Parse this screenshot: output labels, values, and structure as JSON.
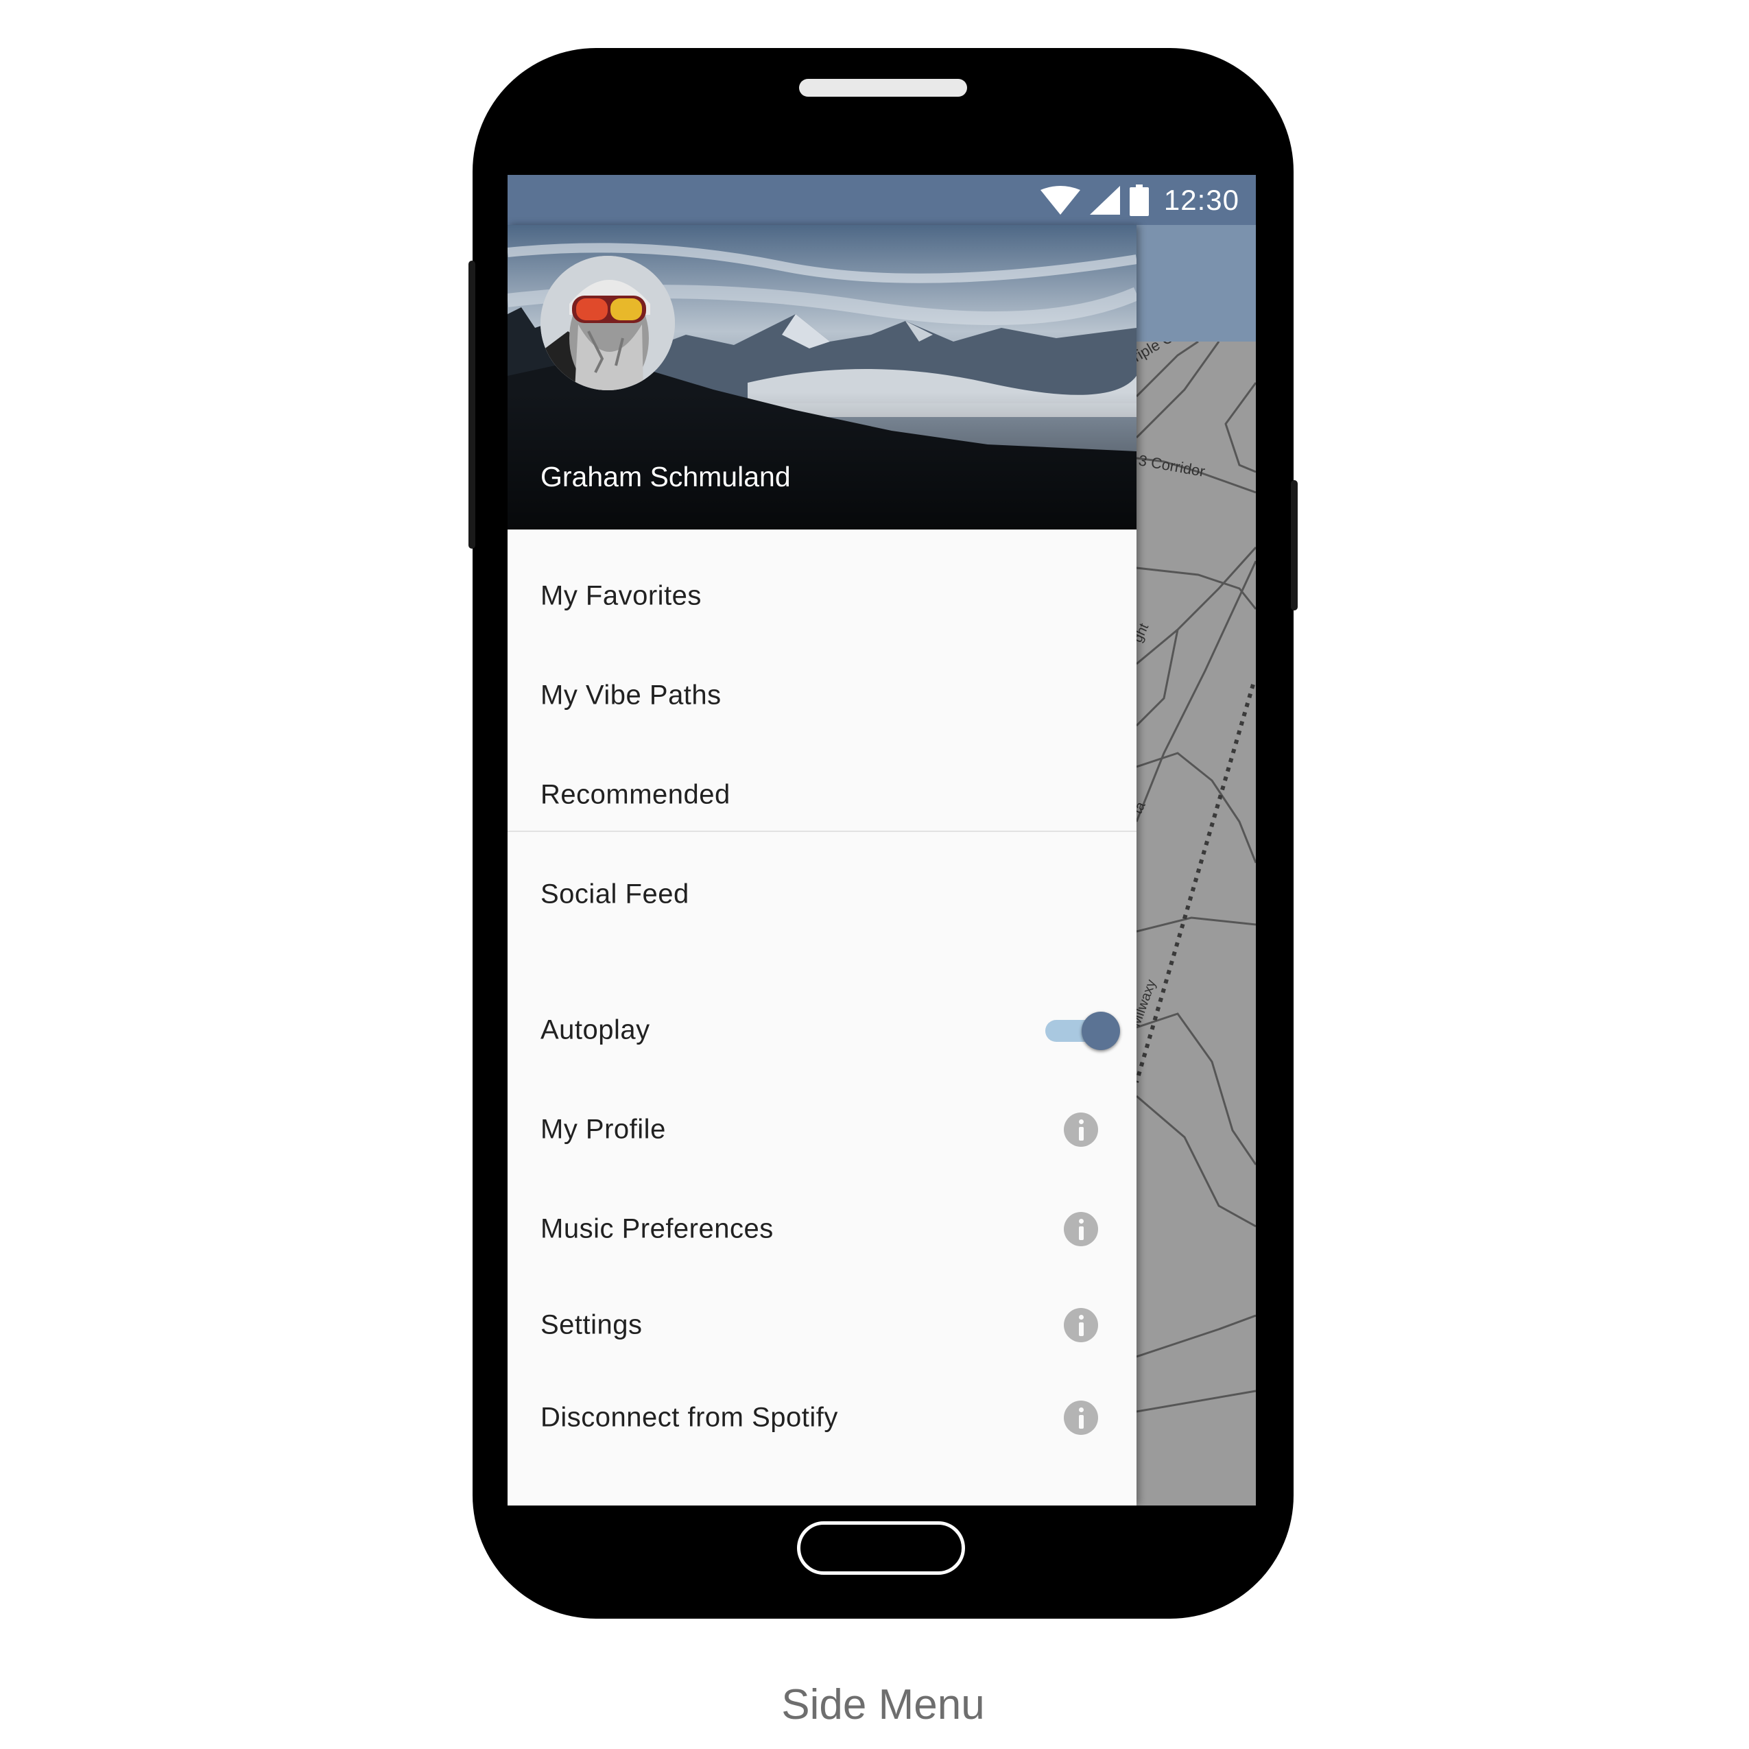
{
  "status_bar": {
    "time": "12:30"
  },
  "drawer": {
    "user_name": "Graham Schmuland",
    "menu_primary": [
      {
        "label": "My Favorites"
      },
      {
        "label": "My Vibe Paths"
      },
      {
        "label": "Recommended"
      },
      {
        "label": "Social Feed"
      }
    ],
    "autoplay": {
      "label": "Autoplay",
      "enabled": true
    },
    "menu_secondary": [
      {
        "label": "My Profile"
      },
      {
        "label": "Music Preferences"
      },
      {
        "label": "Settings"
      },
      {
        "label": "Disconnect from Spotify"
      }
    ]
  },
  "map_labels": [
    "riple C",
    "3 Corridor",
    "ght",
    "ta",
    "Milwaxy"
  ],
  "caption": "Side Menu",
  "colors": {
    "accent": "#5b7394",
    "toggle_track": "#a9c8e0",
    "appbar": "#7b92ad"
  }
}
